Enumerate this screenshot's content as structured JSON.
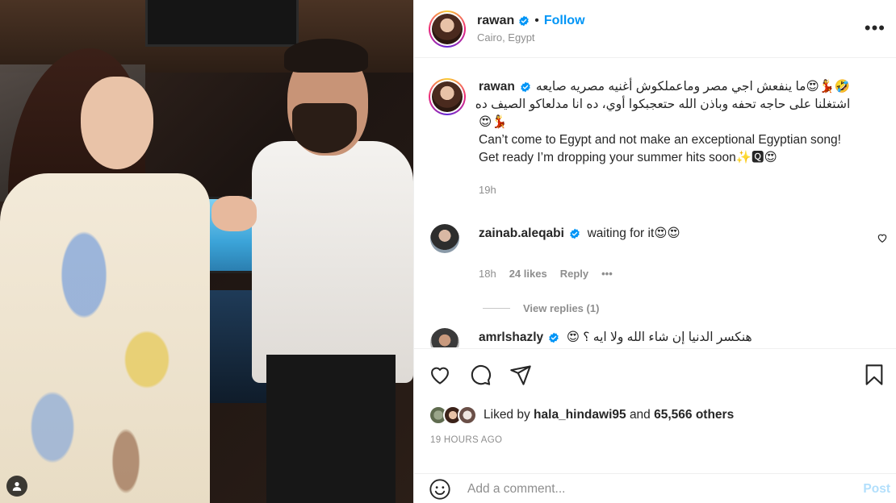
{
  "post": {
    "username": "rawan",
    "follow_label": "Follow",
    "location": "Cairo, Egypt",
    "more_label": "•••"
  },
  "caption": {
    "username": "rawan",
    "line1": "🤣💃😍ما ينفعش اجي مصر وماعملكوش أغنيه مصريه صايعه",
    "line2": "اشتغلنا على حاجه تحفه وباذن الله حتعجبكوا أوي، ده انا مدلعاكو الصيف ده",
    "line3": "😍💃",
    "line4": "Can’t come to Egypt and not make an exceptional Egyptian song!",
    "line5": "Get ready I’m dropping your summer hits soon✨🆀😍",
    "time": "19h"
  },
  "comments": [
    {
      "username": "zainab.aleqabi",
      "text": "waiting for it😍😍",
      "time": "18h",
      "likes": "24 likes",
      "reply_label": "Reply",
      "more_label": "•••",
      "view_replies": "View replies (1)"
    },
    {
      "username": "amrlshazly",
      "text": "هنكسر الدنيا إن شاء الله ولا ايه ؟ 😍"
    }
  ],
  "actions": {
    "liked_by_prefix": "Liked by",
    "liked_by_user": "hala_hindawi95",
    "liked_by_and": "and",
    "liked_by_count": "65,566 others",
    "timestamp": "19 HOURS AGO"
  },
  "add_comment": {
    "placeholder": "Add a comment...",
    "post_label": "Post"
  },
  "colors": {
    "accent": "#0095f6",
    "post_disabled": "#b2dffc",
    "muted": "#8e8e8e"
  },
  "icons": [
    "verified-icon",
    "more-icon",
    "like-icon",
    "comment-icon",
    "share-icon",
    "bookmark-icon",
    "emoji-icon",
    "heart-icon",
    "user-tag-icon"
  ]
}
